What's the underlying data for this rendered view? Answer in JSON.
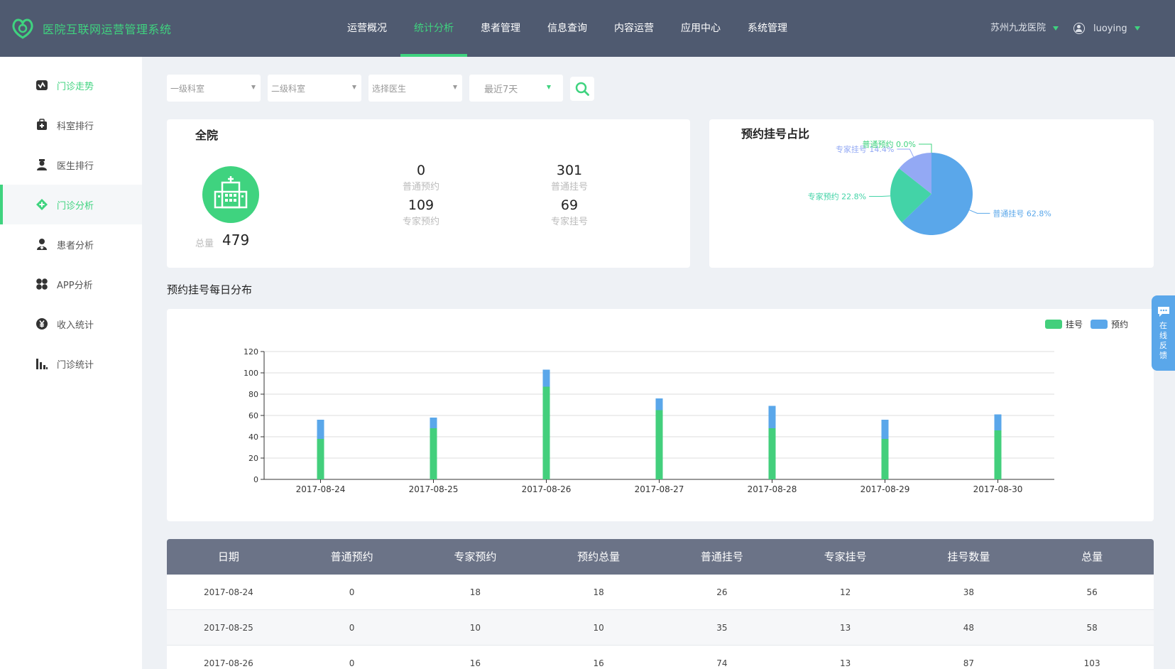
{
  "app": {
    "title": "医院互联网运营管理系统"
  },
  "nav": {
    "items": [
      {
        "label": "运营概况"
      },
      {
        "label": "统计分析"
      },
      {
        "label": "患者管理"
      },
      {
        "label": "信息查询"
      },
      {
        "label": "内容运营"
      },
      {
        "label": "应用中心"
      },
      {
        "label": "系统管理"
      }
    ],
    "active_index": 1
  },
  "header": {
    "hospital": "苏州九龙医院",
    "user": "luoying"
  },
  "sidebar": {
    "items": [
      {
        "label": "门诊走势",
        "icon": "trend-icon"
      },
      {
        "label": "科室排行",
        "icon": "medical-case-icon"
      },
      {
        "label": "医生排行",
        "icon": "doctor-icon"
      },
      {
        "label": "门诊分析",
        "icon": "diamond-plus-icon"
      },
      {
        "label": "患者分析",
        "icon": "patient-icon"
      },
      {
        "label": "APP分析",
        "icon": "app-grid-icon"
      },
      {
        "label": "收入统计",
        "icon": "yen-icon"
      },
      {
        "label": "门诊统计",
        "icon": "bar-chart-icon"
      }
    ],
    "active_index": 3
  },
  "filters": {
    "dept1": "一级科室",
    "dept2": "二级科室",
    "doctor": "选择医生",
    "range": "最近7天"
  },
  "summary": {
    "title": "全院",
    "total_label": "总量",
    "total": "479",
    "stats": [
      {
        "value": "0",
        "label": "普通预约"
      },
      {
        "value": "301",
        "label": "普通挂号"
      },
      {
        "value": "109",
        "label": "专家预约"
      },
      {
        "value": "69",
        "label": "专家挂号"
      }
    ]
  },
  "pie": {
    "title": "预约挂号占比",
    "slices": [
      {
        "name": "普通挂号",
        "pct": 62.8,
        "label": "普通挂号 62.8%",
        "color": "#5aa7ea"
      },
      {
        "name": "专家预约",
        "pct": 22.8,
        "label": "专家预约 22.8%",
        "color": "#43d3a7"
      },
      {
        "name": "专家挂号",
        "pct": 14.4,
        "label": "专家挂号 14.4%",
        "color": "#93a9f4"
      },
      {
        "name": "普通预约",
        "pct": 0.0,
        "label": "普通预约 0.0%",
        "color": "#3fd37f"
      }
    ]
  },
  "daily": {
    "title": "预约挂号每日分布"
  },
  "chart_data": {
    "type": "bar",
    "stacked": true,
    "categories": [
      "2017-08-24",
      "2017-08-25",
      "2017-08-26",
      "2017-08-27",
      "2017-08-28",
      "2017-08-29",
      "2017-08-30"
    ],
    "series": [
      {
        "name": "挂号",
        "values": [
          38,
          48,
          87,
          65,
          48,
          38,
          46
        ],
        "color": "#43cf7c"
      },
      {
        "name": "预约",
        "values": [
          18,
          10,
          16,
          11,
          21,
          18,
          15
        ],
        "color": "#5aa7ea"
      }
    ],
    "ylim": [
      0,
      120
    ],
    "yticks": [
      0,
      20,
      40,
      60,
      80,
      100,
      120
    ],
    "legend": "top-right",
    "grid": true
  },
  "table": {
    "headers": [
      "日期",
      "普通预约",
      "专家预约",
      "预约总量",
      "普通挂号",
      "专家挂号",
      "挂号数量",
      "总量"
    ],
    "rows": [
      [
        "2017-08-24",
        "0",
        "18",
        "18",
        "26",
        "12",
        "38",
        "56"
      ],
      [
        "2017-08-25",
        "0",
        "10",
        "10",
        "35",
        "13",
        "48",
        "58"
      ],
      [
        "2017-08-26",
        "0",
        "16",
        "16",
        "74",
        "13",
        "87",
        "103"
      ]
    ]
  },
  "feedback": {
    "label": "在线反馈"
  }
}
